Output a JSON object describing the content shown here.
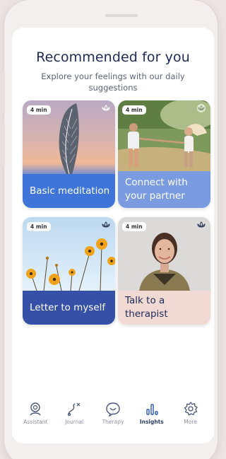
{
  "header": {
    "title": "Recommended for you",
    "subtitle": "Explore your feelings with our daily suggestions"
  },
  "cards": [
    {
      "duration": "4 min",
      "label": "Basic meditation",
      "icon": "lotus-icon",
      "accent": "#3f75d9"
    },
    {
      "duration": "4 min",
      "label": "Connect with your partner",
      "icon": "lotus-icon",
      "accent": "#7a9be0"
    },
    {
      "duration": "4 min",
      "label": "Letter to myself",
      "icon": "lotus-icon",
      "accent": "#3550a6"
    },
    {
      "duration": "4 min",
      "label": "Talk to a therapist",
      "icon": "lotus-icon",
      "accent": "#f1d9d4"
    }
  ],
  "nav": {
    "items": [
      {
        "label": "Assistant",
        "icon": "assistant-icon"
      },
      {
        "label": "Journal",
        "icon": "journal-icon"
      },
      {
        "label": "Therapy",
        "icon": "heart-chat-icon"
      },
      {
        "label": "Insights",
        "icon": "bar-chart-icon",
        "active": true
      },
      {
        "label": "More",
        "icon": "gear-icon"
      }
    ]
  }
}
